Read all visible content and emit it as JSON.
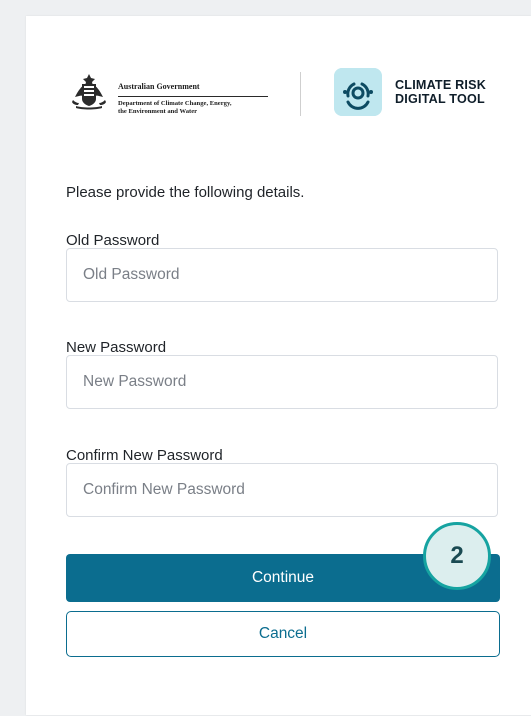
{
  "logos": {
    "gov_title": "Australian Government",
    "gov_department_line1": "Department of Climate Change, Energy,",
    "gov_department_line2": "the Environment and Water",
    "product_name_line1": "CLIMATE RISK",
    "product_name_line2": "DIGITAL TOOL"
  },
  "form": {
    "intro": "Please provide the following details.",
    "old_password": {
      "label": "Old Password",
      "placeholder": "Old Password",
      "value": ""
    },
    "new_password": {
      "label": "New Password",
      "placeholder": "New Password",
      "value": ""
    },
    "confirm_password": {
      "label": "Confirm New Password",
      "placeholder": "Confirm New Password",
      "value": ""
    },
    "continue_label": "Continue",
    "cancel_label": "Cancel"
  },
  "annotation": {
    "step_number": "2"
  },
  "colors": {
    "primary": "#0b6d8f",
    "icon_bg": "#bfe7ef",
    "badge_border": "#16a3a1",
    "badge_bg": "#dceeee"
  },
  "icons": {
    "gov_crest": "coat-of-arms-icon",
    "product": "climate-risk-digital-tool-icon"
  }
}
